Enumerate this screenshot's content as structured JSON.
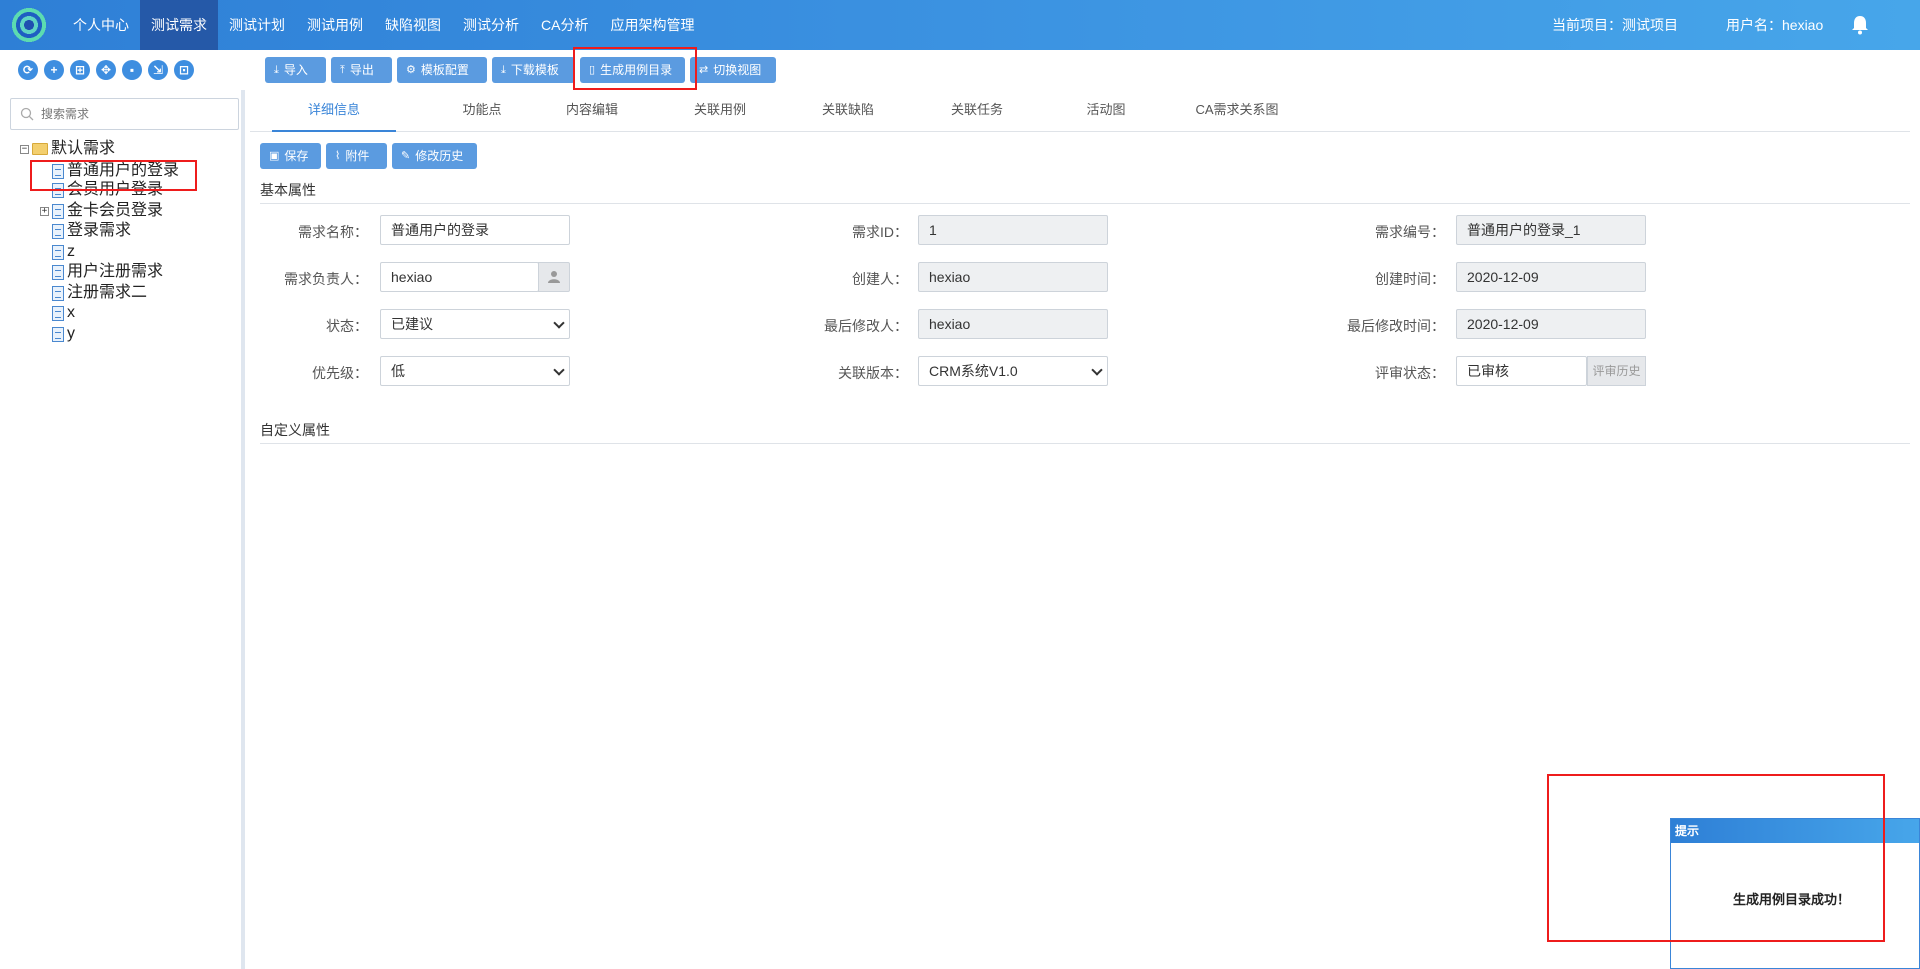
{
  "nav": {
    "items": [
      "个人中心",
      "测试需求",
      "测试计划",
      "测试用例",
      "缺陷视图",
      "测试分析",
      "CA分析",
      "应用架构管理"
    ],
    "active_index": 1,
    "current_project": "当前项目：测试项目",
    "username": "用户名：hexiao",
    "bell_icon": "bell-icon"
  },
  "left_tools": {
    "icons": [
      "refresh-icon",
      "add-icon",
      "grid-icon",
      "move-icon",
      "delete-icon",
      "export-icon",
      "import-icon"
    ],
    "glyphs": [
      "⟳",
      "+",
      "⊞",
      "✥",
      "🗑",
      "⇲",
      "⊡"
    ]
  },
  "toolbar": {
    "import": "导入",
    "export": "导出",
    "template_config": "模板配置",
    "download_template": "下载模板",
    "generate_case_dir": "生成用例目录",
    "switch_view": "切换视图"
  },
  "sidebar": {
    "search_placeholder": "搜索需求",
    "tree": {
      "root": "默认需求",
      "items": [
        "普通用户的登录",
        "会员用户登录",
        "金卡会员登录",
        "登录需求",
        "z",
        "用户注册需求",
        "注册需求二",
        "x",
        "y"
      ]
    }
  },
  "tabs": [
    "详细信息",
    "功能点",
    "内容编辑",
    "关联用例",
    "关联缺陷",
    "关联任务",
    "活动图",
    "CA需求关系图"
  ],
  "actions": {
    "save": "保存",
    "attachment": "附件",
    "history": "修改历史"
  },
  "basic": {
    "title": "基本属性",
    "name_label": "需求名称：",
    "name_value": "普通用户的登录",
    "id_label": "需求ID：",
    "id_value": "1",
    "code_label": "需求编号：",
    "code_value": "普通用户的登录_1",
    "owner_label": "需求负责人：",
    "owner_value": "hexiao",
    "creator_label": "创建人：",
    "creator_value": "hexiao",
    "created_label": "创建时间：",
    "created_value": "2020-12-09",
    "status_label": "状态：",
    "status_value": "已建议",
    "modifier_label": "最后修改人：",
    "modifier_value": "hexiao",
    "modified_label": "最后修改时间：",
    "modified_value": "2020-12-09",
    "priority_label": "优先级：",
    "priority_value": "低",
    "version_label": "关联版本：",
    "version_value": "CRM系统V1.0",
    "review_label": "评审状态：",
    "review_value": "已审核",
    "review_history": "评审历史"
  },
  "custom": {
    "title": "自定义属性"
  },
  "toast": {
    "title": "提示",
    "message": "生成用例目录成功！"
  },
  "colors": {
    "accent": "#3a85d8",
    "highlight": "#ee1c1c",
    "button": "#5b9be0"
  }
}
